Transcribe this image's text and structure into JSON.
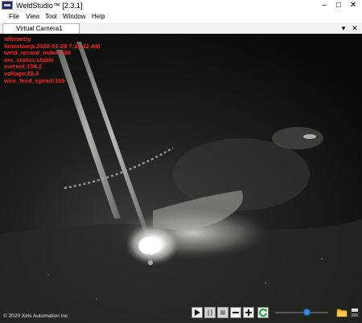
{
  "window": {
    "title": "WeldStudio™ [2.3.1]",
    "minimize_glyph": "–",
    "maximize_glyph": "□",
    "close_glyph": "✕"
  },
  "menu": [
    "File",
    "View",
    "Tool",
    "Window",
    "Help"
  ],
  "tabs": {
    "active_label": "Virtual Camera1",
    "dropdown_glyph": "▾",
    "close_glyph": "✕"
  },
  "overlay": {
    "telemetry_lines": [
      "telemetry",
      "timestamp:2020-07-29 7:11:42 AM",
      "weld_record_index:158",
      "arc_status:stable",
      "current:154.1",
      "voltage:22.4",
      "wire_feed_speed:169"
    ],
    "copyright": "© 2020 Xiris Automation Inc"
  },
  "controls": {
    "buttons": [
      {
        "name": "play-button",
        "icon": "play-icon",
        "enabled": true
      },
      {
        "name": "pause-button",
        "icon": "pause-icon",
        "enabled": false
      },
      {
        "name": "stop-button",
        "icon": "stop-icon",
        "enabled": false
      },
      {
        "name": "zoom-out-button",
        "icon": "minus-icon",
        "enabled": true
      },
      {
        "name": "zoom-in-button",
        "icon": "plus-icon",
        "enabled": true
      },
      {
        "name": "loop-button",
        "icon": "refresh-icon",
        "enabled": true
      }
    ],
    "playback_position": 0.6,
    "icons": {
      "open": "folder-icon",
      "save": "save-icon"
    }
  },
  "colors": {
    "telemetry_text": "#ff1a1a",
    "slider_thumb": "#2f8fe0",
    "loop_icon": "#1e9c3a",
    "folder_icon": "#f0b429"
  }
}
